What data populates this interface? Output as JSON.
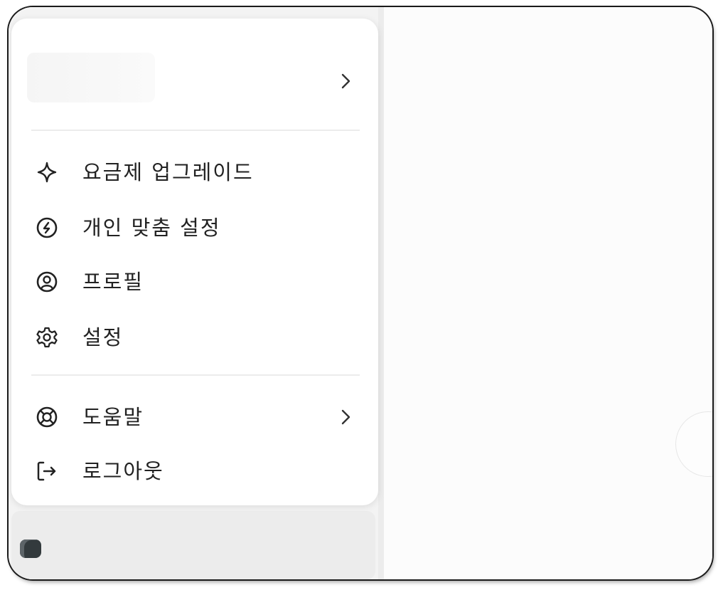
{
  "menu": {
    "upgrade": {
      "label": "요금제 업그레이드",
      "icon": "sparkle-icon"
    },
    "personalize": {
      "label": "개인 맞춤 설정",
      "icon": "personalization-icon"
    },
    "profile": {
      "label": "프로필",
      "icon": "profile-icon"
    },
    "settings": {
      "label": "설정",
      "icon": "gear-icon"
    },
    "help": {
      "label": "도움말",
      "icon": "lifebuoy-icon"
    },
    "logout": {
      "label": "로그아웃",
      "icon": "logout-icon"
    }
  },
  "account": {
    "avatar_icon": "avatar"
  },
  "colors": {
    "text": "#222222",
    "menu_bg": "#ffffff",
    "divider": "#ececec"
  }
}
